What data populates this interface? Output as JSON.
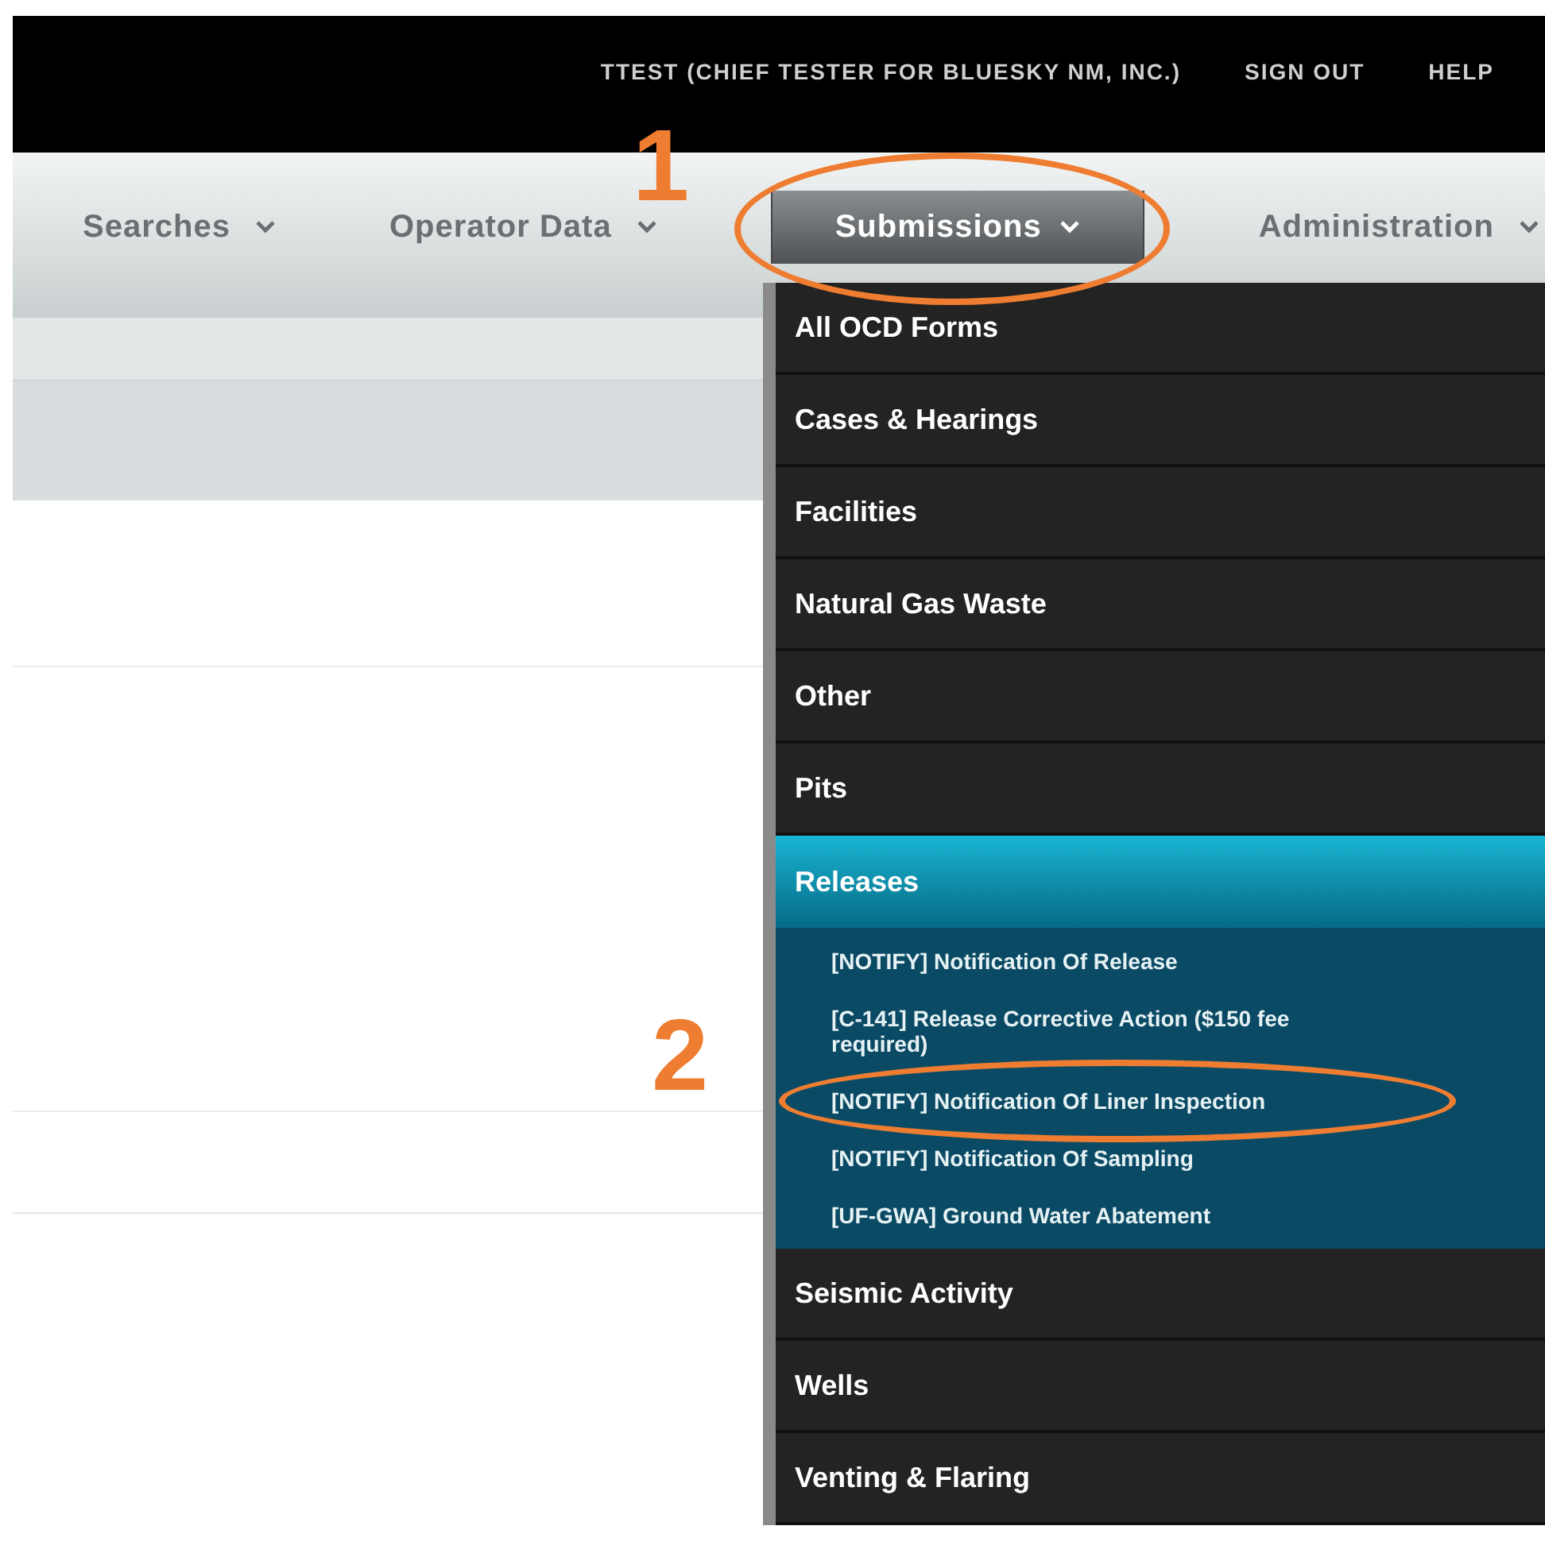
{
  "header": {
    "user": "TTEST (CHIEF TESTER FOR BLUESKY NM, INC.)",
    "links": [
      "SIGN OUT",
      "HELP"
    ]
  },
  "nav": [
    {
      "label": "Searches",
      "selected": false
    },
    {
      "label": "Operator Data",
      "selected": false
    },
    {
      "label": "Submissions",
      "selected": true
    },
    {
      "label": "Administration",
      "selected": false
    }
  ],
  "dropdown": [
    {
      "label": "All OCD Forms",
      "selected": false
    },
    {
      "label": "Cases & Hearings",
      "selected": false
    },
    {
      "label": "Facilities",
      "selected": false
    },
    {
      "label": "Natural Gas Waste",
      "selected": false
    },
    {
      "label": "Other",
      "selected": false
    },
    {
      "label": "Pits",
      "selected": false
    },
    {
      "label": "Releases",
      "selected": true,
      "children": [
        {
          "label": "[NOTIFY] Notification Of Release"
        },
        {
          "label": "[C-141] Release Corrective Action ($150 fee required)"
        },
        {
          "label": "[NOTIFY] Notification Of Liner Inspection"
        },
        {
          "label": "[NOTIFY] Notification Of Sampling"
        },
        {
          "label": "[UF-GWA] Ground Water Abatement"
        }
      ]
    },
    {
      "label": "Seismic Activity",
      "selected": false
    },
    {
      "label": "Wells",
      "selected": false
    },
    {
      "label": "Venting & Flaring",
      "selected": false
    }
  ],
  "annotations": [
    {
      "label": "1"
    },
    {
      "label": "2"
    }
  ]
}
